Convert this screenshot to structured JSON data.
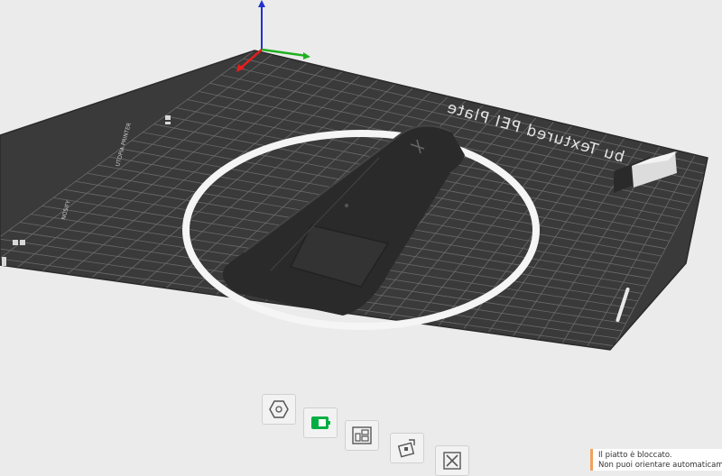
{
  "plate": {
    "title": "bu Textured PEI Plate",
    "left_edge_label": "UTOPIA PRINTER",
    "left_edge_label_2": "NOSIFY"
  },
  "notification": {
    "line1": "Il piatto è bloccato.",
    "line2": "Non puoi orientare automaticamente"
  },
  "toolbar": {
    "buttons": [
      {
        "name": "home-view-button",
        "icon": "octagon-icon"
      },
      {
        "name": "toggle-lock-button",
        "icon": "battery-icon"
      },
      {
        "name": "arrange-button",
        "icon": "arrange-icon"
      },
      {
        "name": "orient-button",
        "icon": "orient-icon"
      },
      {
        "name": "close-button",
        "icon": "close-icon"
      }
    ]
  },
  "colors": {
    "background": "#ebebeb",
    "bed": "#3a3a3a",
    "grid": "#6a6a6a",
    "model": "#2a2a2a",
    "ring": "#f5f5f5",
    "axis_x": "#e02020",
    "axis_y": "#20b020",
    "axis_z": "#2030d0",
    "accent": "#00ae42",
    "warning": "#f0a25c"
  }
}
